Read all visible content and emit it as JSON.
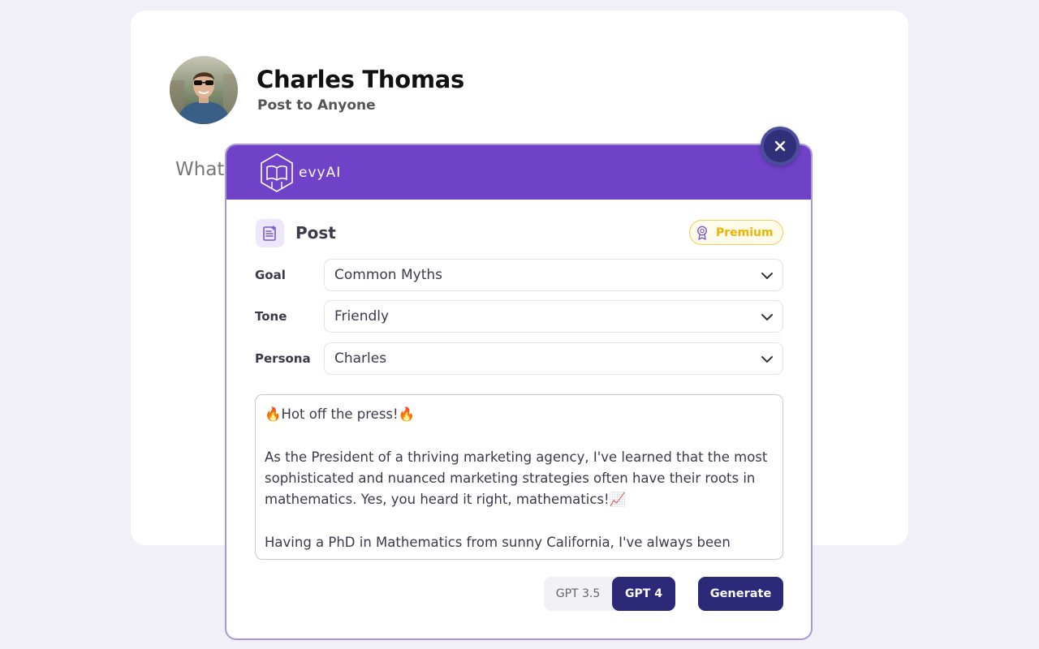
{
  "composer": {
    "author_name": "Charles Thomas",
    "audience": "Post to Anyone",
    "placeholder": "What"
  },
  "modal": {
    "brand": "evyAI",
    "section_title": "Post",
    "premium_label": "Premium",
    "fields": [
      {
        "label": "Goal",
        "value": "Common Myths"
      },
      {
        "label": "Tone",
        "value": "Friendly"
      },
      {
        "label": "Persona",
        "value": "Charles"
      }
    ],
    "post_lines": {
      "p1": "🔥Hot off the press!🔥",
      "p2": "As the President of a thriving marketing agency, I've learned that the most sophisticated and nuanced marketing strategies often have their roots in mathematics. Yes, you heard it right, mathematics!📈",
      "p3": "Having a PhD in Mathematics from sunny California, I've always been"
    },
    "models": {
      "gpt35": "GPT 3.5",
      "gpt4": "GPT 4",
      "selected": "GPT 4"
    },
    "generate_label": "Generate"
  },
  "colors": {
    "page_bg": "#f1eff8",
    "header_purple": "#6f42c8",
    "primary_navy": "#2c2a78",
    "premium_gold": "#f0b400"
  },
  "icons": [
    "avatar-photo",
    "evyai-logo-icon",
    "close-icon",
    "post-edit-icon",
    "premium-award-icon",
    "chevron-down-icon"
  ]
}
